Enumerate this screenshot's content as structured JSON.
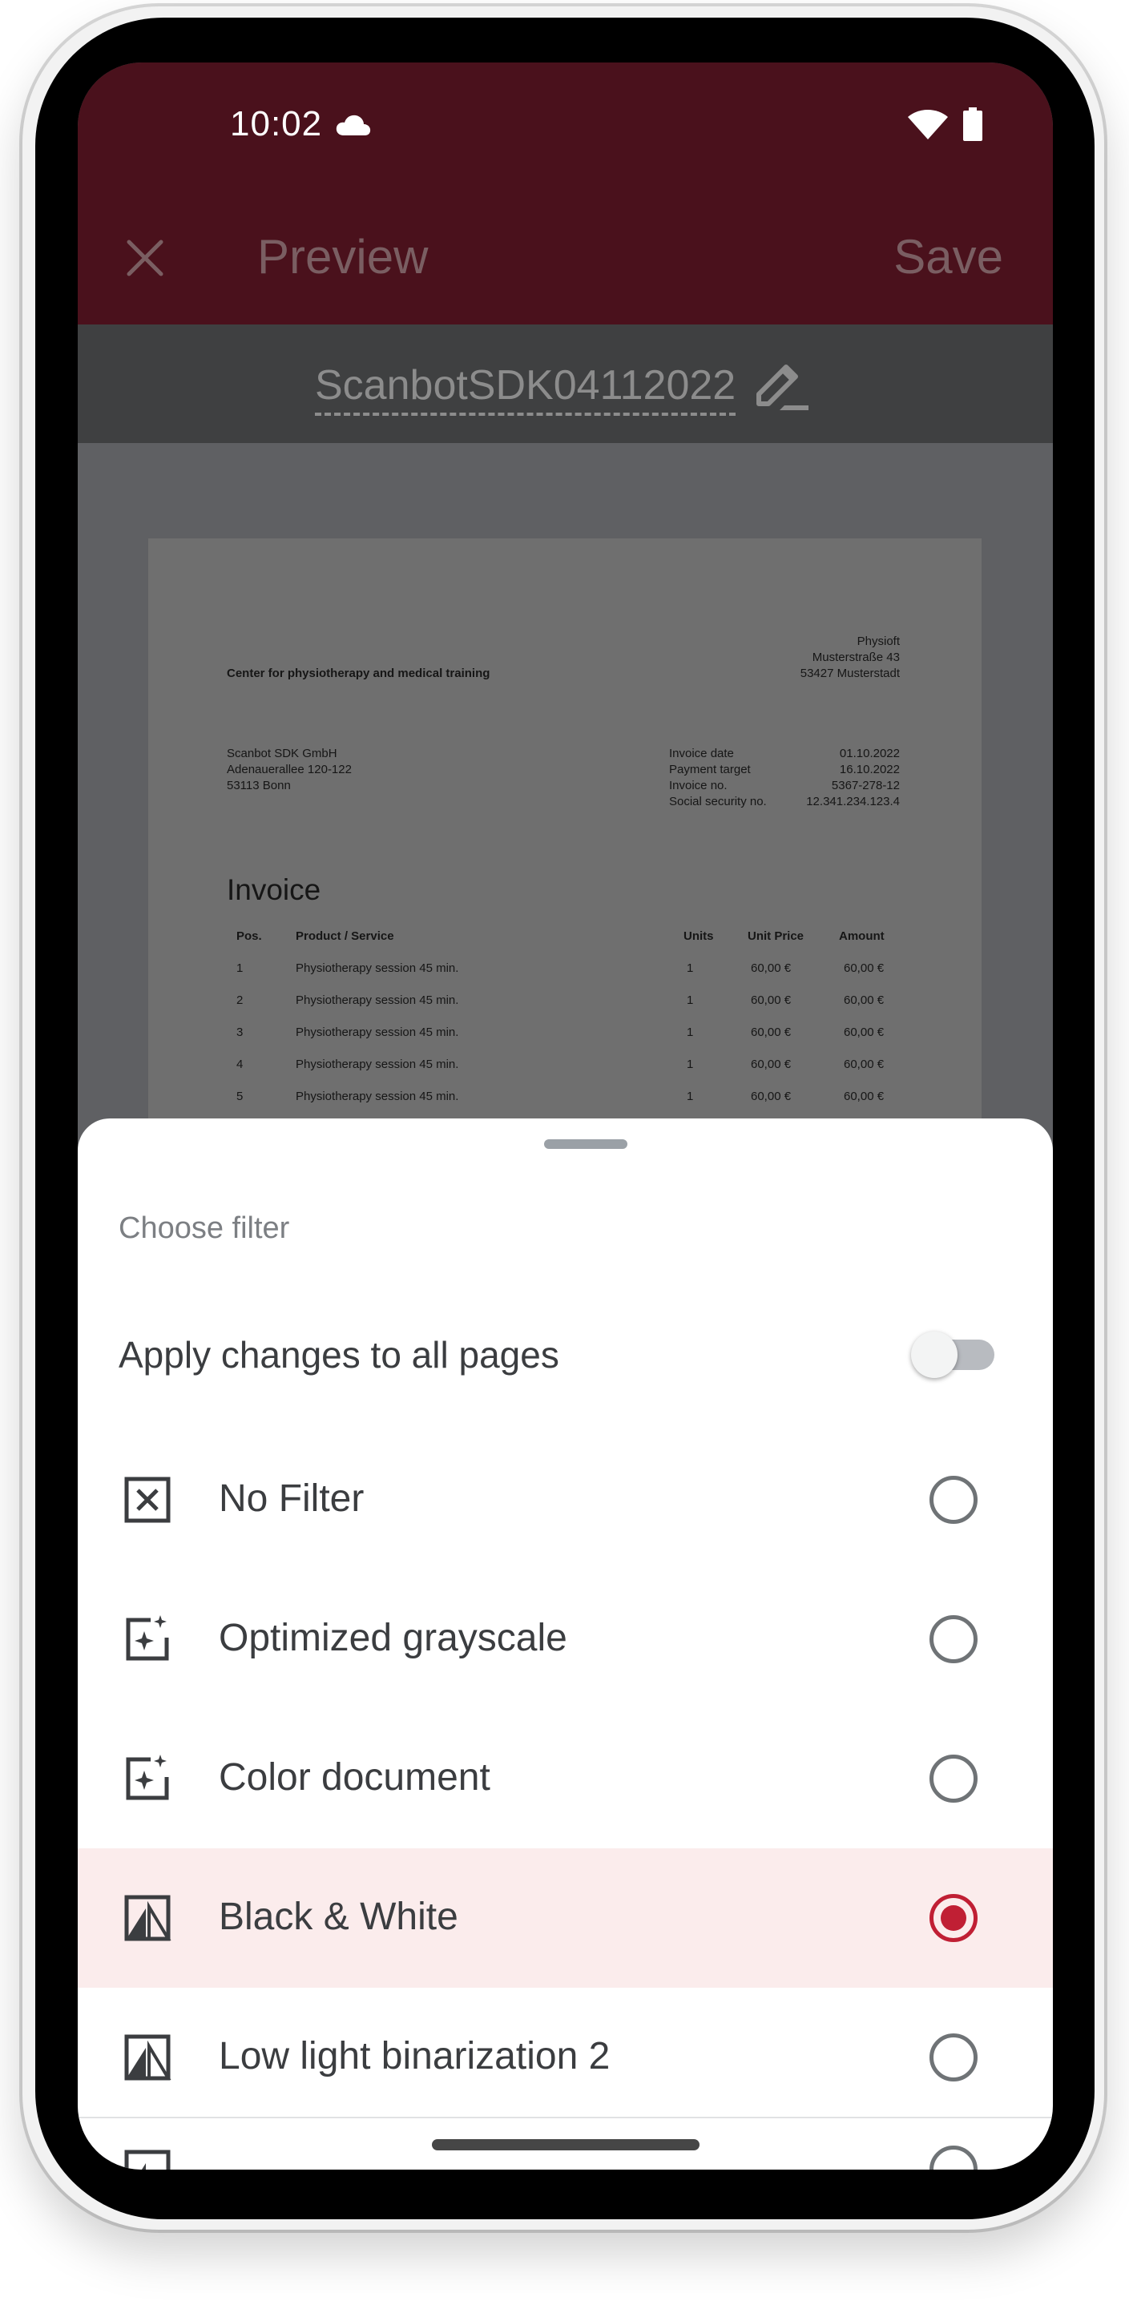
{
  "status_bar": {
    "time": "10:02",
    "icons": [
      "cloud-icon",
      "wifi-icon",
      "battery-icon"
    ]
  },
  "app_bar": {
    "title": "Preview",
    "save_label": "Save",
    "close_icon": "close-icon"
  },
  "document": {
    "filename": "ScanbotSDK04112022",
    "edit_icon": "pencil-icon",
    "sender_name": "Center for physiotherapy and medical training",
    "sender_address": [
      "Physioft",
      "Musterstraße 43",
      "53427 Musterstadt"
    ],
    "recipient_address": [
      "Scanbot SDK GmbH",
      "Adenauerallee 120-122",
      "53113 Bonn"
    ],
    "meta_labels": [
      "Invoice date",
      "Payment target",
      "Invoice no.",
      "Social security no."
    ],
    "meta_values": [
      "01.10.2022",
      "16.10.2022",
      "5367-278-12",
      "12.341.234.123.4"
    ],
    "heading": "Invoice",
    "table_headers": [
      "Pos.",
      "Product / Service",
      "Units",
      "Unit Price",
      "Amount"
    ],
    "table_rows": [
      [
        "1",
        "Physiotherapy session 45 min.",
        "1",
        "60,00 €",
        "60,00 €"
      ],
      [
        "2",
        "Physiotherapy session 45 min.",
        "1",
        "60,00 €",
        "60,00 €"
      ],
      [
        "3",
        "Physiotherapy session 45 min.",
        "1",
        "60,00 €",
        "60,00 €"
      ],
      [
        "4",
        "Physiotherapy session 45 min.",
        "1",
        "60,00 €",
        "60,00 €"
      ],
      [
        "5",
        "Physiotherapy session 45 min.",
        "1",
        "60,00 €",
        "60,00 €"
      ]
    ]
  },
  "sheet": {
    "title": "Choose filter",
    "apply_all_label": "Apply changes to all pages",
    "apply_all_enabled": false,
    "filters": [
      {
        "label": "No Filter",
        "icon": "no-filter-icon",
        "selected": false
      },
      {
        "label": "Optimized grayscale",
        "icon": "sparkle-image-icon",
        "selected": false
      },
      {
        "label": "Color document",
        "icon": "sparkle-image-icon",
        "selected": false
      },
      {
        "label": "Black & White",
        "icon": "black-white-icon",
        "selected": true
      },
      {
        "label": "Low light binarization 2",
        "icon": "black-white-icon",
        "selected": false
      }
    ]
  },
  "colors": {
    "accent": "#c01f34",
    "selected_row": "#fbecec",
    "app_bar_dimmed": "#4a111c"
  }
}
